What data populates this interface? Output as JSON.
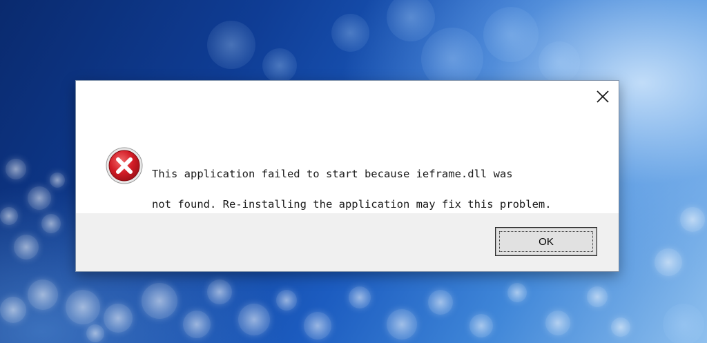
{
  "dialog": {
    "message_line1": "This application failed to start because ieframe.dll was",
    "message_line2": "not found. Re-installing the application may fix this problem.",
    "ok_label": "OK",
    "icon": "error-icon",
    "close_icon": "close-icon"
  },
  "colors": {
    "error_red": "#c8102e",
    "dialog_bg": "#ffffff",
    "footer_bg": "#f0f0f0"
  }
}
